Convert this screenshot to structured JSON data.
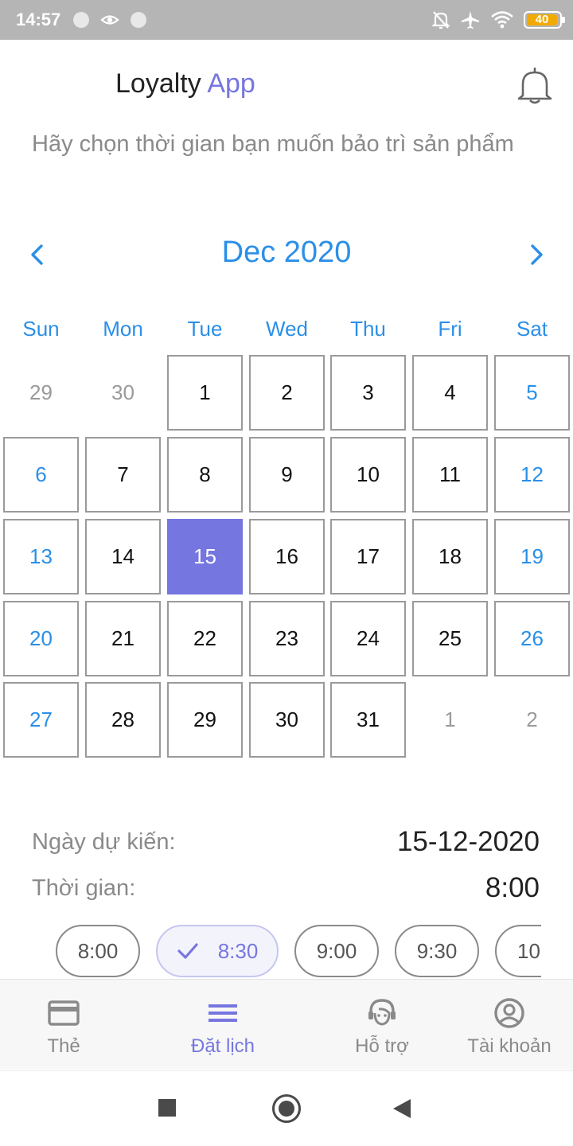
{
  "status_bar": {
    "time": "14:57",
    "battery": "40",
    "icons": [
      "notification-dot-icon",
      "eye-comfort-icon",
      "notification-dot-icon",
      "alarm-off-icon",
      "airplane-icon",
      "wifi-icon",
      "battery-icon"
    ]
  },
  "header": {
    "title_main": "Loyalty",
    "title_accent": "App",
    "accent_color": "#7676e0",
    "notification_icon": "bell-icon"
  },
  "subtitle": "Hãy chọn thời gian bạn muốn bảo trì sản phẩm",
  "calendar": {
    "month_label": "Dec 2020",
    "prev_icon": "chevron-left-icon",
    "next_icon": "chevron-right-icon",
    "weekdays": [
      "Sun",
      "Mon",
      "Tue",
      "Wed",
      "Thu",
      "Fri",
      "Sat"
    ],
    "weeks": [
      [
        "29",
        "30",
        "1",
        "2",
        "3",
        "4",
        "5"
      ],
      [
        "6",
        "7",
        "8",
        "9",
        "10",
        "11",
        "12"
      ],
      [
        "13",
        "14",
        "15",
        "16",
        "17",
        "18",
        "19"
      ],
      [
        "20",
        "21",
        "22",
        "23",
        "24",
        "25",
        "26"
      ],
      [
        "27",
        "28",
        "29",
        "30",
        "31",
        "1",
        "2"
      ]
    ],
    "selected_day": "15",
    "accent_color": "#2b8fe8",
    "selected_color": "#7676e0"
  },
  "summary": {
    "date_label": "Ngày dự kiến:",
    "date_value": "15-12-2020",
    "time_label": "Thời gian:",
    "time_value": "8:00"
  },
  "time_slots": [
    {
      "label": "8:00",
      "selected": false
    },
    {
      "label": "8:30",
      "selected": true
    },
    {
      "label": "9:00",
      "selected": false
    },
    {
      "label": "9:30",
      "selected": false
    },
    {
      "label": "10",
      "selected": false
    }
  ],
  "bottom_nav": [
    {
      "label": "Thẻ",
      "icon": "card-icon",
      "active": false
    },
    {
      "label": "Đặt lịch",
      "icon": "menu-lines-icon",
      "active": true
    },
    {
      "label": "Hỗ trợ",
      "icon": "support-agent-icon",
      "active": false
    },
    {
      "label": "Tài khoản",
      "icon": "account-circle-icon",
      "active": false
    }
  ],
  "system_nav": [
    "recents-square-icon",
    "home-circle-icon",
    "back-triangle-icon"
  ]
}
